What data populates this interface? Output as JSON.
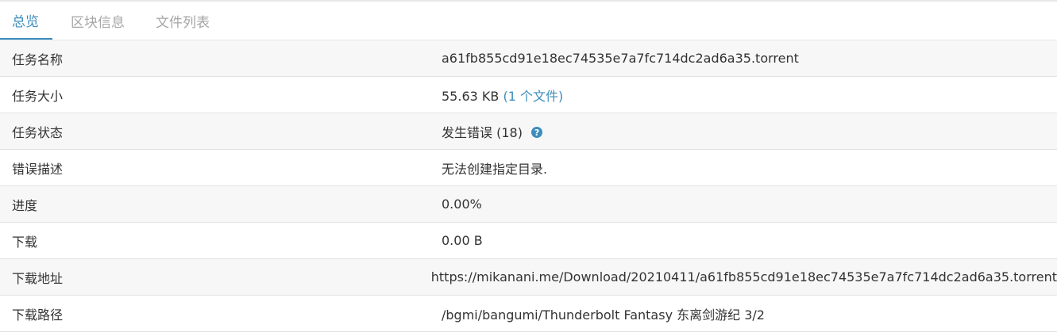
{
  "tabs": [
    {
      "label": "总览",
      "active": true
    },
    {
      "label": "区块信息",
      "active": false
    },
    {
      "label": "文件列表",
      "active": false
    }
  ],
  "rows": [
    {
      "label": "任务名称",
      "value": "a61fb855cd91e18ec74535e7a7fc714dc2ad6a35.torrent"
    },
    {
      "label": "任务大小",
      "value": "55.63 KB",
      "link": "(1 个文件)"
    },
    {
      "label": "任务状态",
      "value": "发生错误 (18)",
      "icon": "question-circle-icon"
    },
    {
      "label": "错误描述",
      "value": "无法创建指定目录."
    },
    {
      "label": "进度",
      "value": "0.00%"
    },
    {
      "label": "下载",
      "value": "0.00 B"
    },
    {
      "label": "下载地址",
      "value": "https://mikanani.me/Download/20210411/a61fb855cd91e18ec74535e7a7fc714dc2ad6a35.torrent"
    },
    {
      "label": "下载路径",
      "value": "/bgmi/bangumi/Thunderbolt Fantasy 东离剑游纪 3/2"
    }
  ],
  "colors": {
    "accent": "#3c8dbc",
    "tab_inactive": "#a6a6a6",
    "row_alt": "#f7f7f7",
    "border": "#e2e2e2"
  },
  "icons": {
    "help": "?"
  }
}
